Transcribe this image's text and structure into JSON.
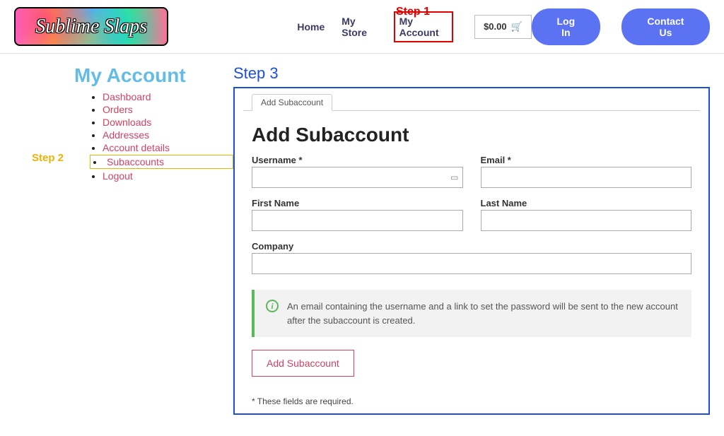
{
  "header": {
    "logo_text": "Sublime Slaps",
    "nav": {
      "home": "Home",
      "mystore": "My Store",
      "myaccount": "My Account"
    },
    "cart_total": "$0.00",
    "login": "Log In",
    "contact": "Contact Us"
  },
  "annotations": {
    "step1": "Step 1",
    "step2": "Step 2",
    "step3": "Step 3"
  },
  "sidebar": {
    "title": "My Account",
    "items": {
      "dashboard": "Dashboard",
      "orders": "Orders",
      "downloads": "Downloads",
      "addresses": "Addresses",
      "account_details": "Account details",
      "subaccounts": "Subaccounts",
      "logout": "Logout"
    }
  },
  "form": {
    "tab": "Add Subaccount",
    "heading": "Add Subaccount",
    "labels": {
      "username": "Username *",
      "email": "Email *",
      "first_name": "First Name",
      "last_name": "Last Name",
      "company": "Company"
    },
    "values": {
      "username": "",
      "email": "",
      "first_name": "",
      "last_name": "",
      "company": ""
    },
    "info": "An email containing the username and a link to set the password will be sent to the new account after the subaccount is created.",
    "submit": "Add Subaccount",
    "footnote": "* These fields are required."
  }
}
